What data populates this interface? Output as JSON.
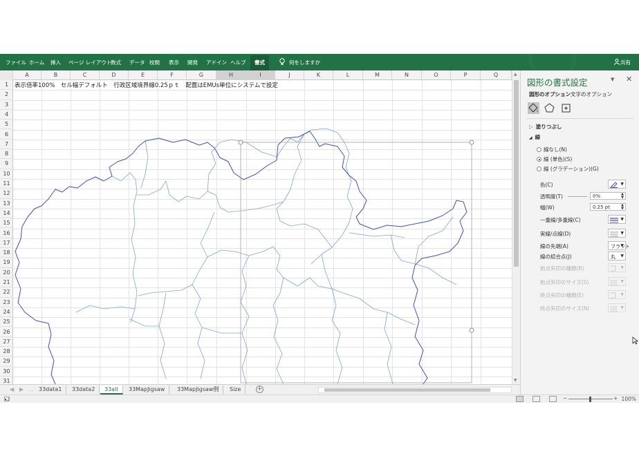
{
  "ribbon": {
    "tabs": [
      "ファイル",
      "ホーム",
      "挿入",
      "ページ レイアウト",
      "数式",
      "データ",
      "校閲",
      "表示",
      "開発",
      "アドイン",
      "ヘルプ",
      "書式"
    ],
    "active_tab": "書式",
    "tell_me": "何をしますか",
    "share": "共有",
    "color": "#217346"
  },
  "sheet": {
    "columns": [
      "A",
      "B",
      "C",
      "D",
      "E",
      "F",
      "G",
      "H",
      "I",
      "J",
      "K",
      "L",
      "M",
      "N",
      "O",
      "P",
      "Q"
    ],
    "selected_columns": [
      "H",
      "I"
    ],
    "rows": [
      "1",
      "2",
      "3",
      "4",
      "5",
      "6",
      "7",
      "8",
      "9",
      "10",
      "11",
      "12",
      "13",
      "14",
      "15",
      "16",
      "17",
      "18",
      "19",
      "20",
      "21",
      "22",
      "23",
      "24",
      "25",
      "26",
      "27",
      "28",
      "29",
      "30",
      "31"
    ],
    "a1_text": "表示倍率100%　セル幅デフォルト　行政区域境界線0.25ｐｔ　配置はEMUs単位にシステムで設定"
  },
  "tabs": {
    "sheets": [
      "33data1",
      "33data2",
      "33all",
      "33MapJigsaw",
      "33MapJigsaw例",
      "Size"
    ],
    "active": "33all"
  },
  "status": {
    "zoom": "100%"
  },
  "pane": {
    "title": "図形の書式設定",
    "option_tabs": [
      "図形のオプション",
      "文字のオプション"
    ],
    "fill_section": "塗りつぶし",
    "line_section": "線",
    "radios": [
      "線なし(N)",
      "線 (単色)(S)",
      "線 (グラデーション)(G)"
    ],
    "selected_radio": 1,
    "color_label": "色(C)",
    "transparency_label": "透明度(T)",
    "transparency_value": "0%",
    "width_label": "幅(W)",
    "width_value": "0.25 pt",
    "compound_label": "一重線/多重線(C)",
    "dash_label": "実線/点線(D)",
    "cap_label": "線の先端(A)",
    "cap_value": "フラット",
    "join_label": "線の結合点(J)",
    "join_value": "丸",
    "begin_arrow_type": "始点矢印の種類(B)",
    "begin_arrow_size": "始点矢印のサイズ(S)",
    "end_arrow_type": "終点矢印の種類(E)",
    "end_arrow_size": "終点矢印のサイズ(N)"
  },
  "map": {
    "outer_color": "#3b4fd0",
    "inner_color": "#7fa6d8"
  }
}
